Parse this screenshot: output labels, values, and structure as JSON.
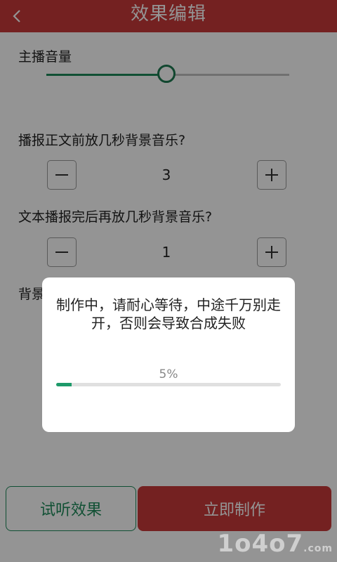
{
  "header": {
    "title": "效果编辑",
    "back_icon": "chevron-left-icon"
  },
  "volume": {
    "label": "主播音量",
    "level_fraction": 0.51
  },
  "pre_music": {
    "label": "播报正文前放几秒背景音乐?",
    "value": "3"
  },
  "post_music": {
    "label": "文本播报完后再放几秒背景音乐?",
    "value": "1"
  },
  "partial_label": "背景",
  "bottom": {
    "preview_label": "试听效果",
    "make_label": "立即制作"
  },
  "dialog": {
    "message": "制作中，请耐心等待，中途千万别走开，否则会导致合成失败",
    "progress_text": "5%",
    "progress_fraction": 0.07
  },
  "watermark": {
    "text": "1o4o7",
    "suffix": ".com"
  },
  "colors": {
    "title_bar": "#c93a3a",
    "accent_green": "#1e8a5a",
    "overlay": "rgba(0,0,0,0.42)"
  }
}
